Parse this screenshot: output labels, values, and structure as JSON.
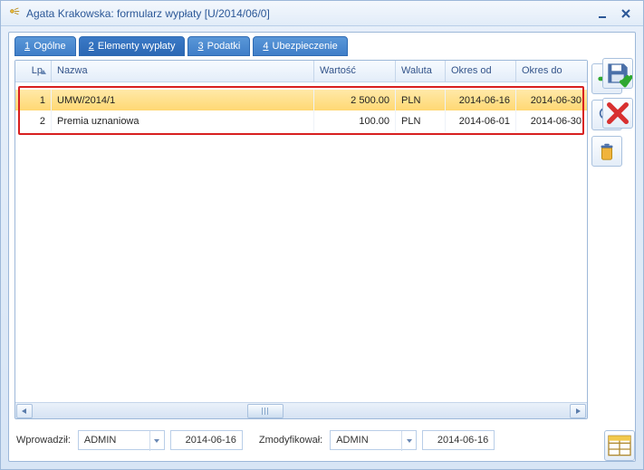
{
  "window": {
    "title": "Agata Krakowska: formularz wypłaty [U/2014/06/0]"
  },
  "tabs": [
    {
      "num": "1",
      "label": "Ogólne"
    },
    {
      "num": "2",
      "label": "Elementy wypłaty"
    },
    {
      "num": "3",
      "label": "Podatki"
    },
    {
      "num": "4",
      "label": "Ubezpieczenie"
    }
  ],
  "active_tab": 1,
  "grid": {
    "headers": {
      "lp": "Lp.",
      "name": "Nazwa",
      "value": "Wartość",
      "currency": "Waluta",
      "from": "Okres od",
      "to": "Okres do"
    },
    "rows": [
      {
        "lp": "1",
        "name": "UMW/2014/1",
        "value": "2 500.00",
        "currency": "PLN",
        "from": "2014-06-16",
        "to": "2014-06-30",
        "selected": true
      },
      {
        "lp": "2",
        "name": "Premia uznaniowa",
        "value": "100.00",
        "currency": "PLN",
        "from": "2014-06-01",
        "to": "2014-06-30",
        "selected": false
      }
    ]
  },
  "footer": {
    "entered_label": "Wprowadził:",
    "entered_by": "ADMIN",
    "entered_date": "2014-06-16",
    "modified_label": "Zmodyfikował:",
    "modified_by": "ADMIN",
    "modified_date": "2014-06-16"
  }
}
